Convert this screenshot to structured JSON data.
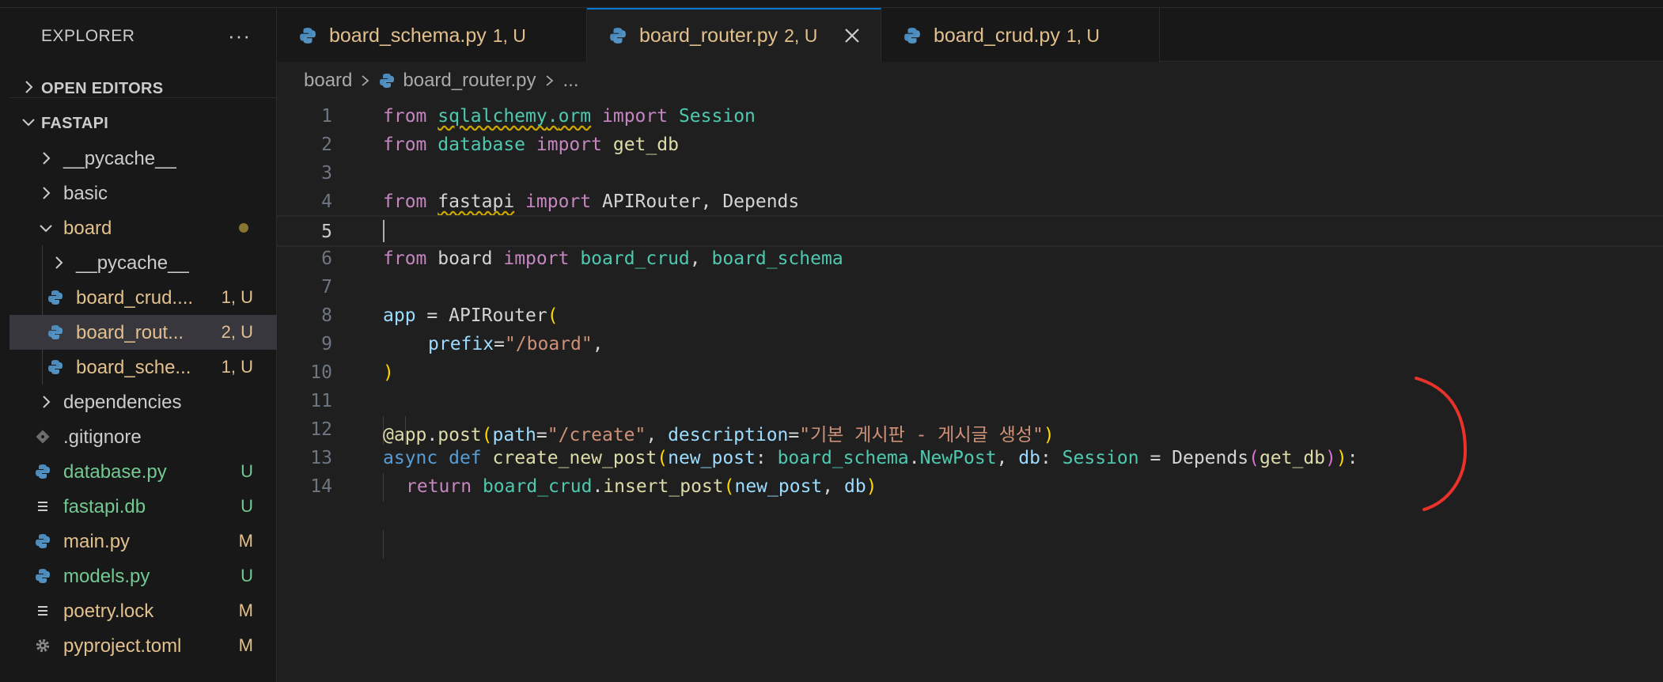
{
  "explorer": {
    "title": "EXPLORER",
    "more": "···",
    "sections": {
      "open_editors": "OPEN EDITORS",
      "project": "FASTAPI"
    },
    "items": [
      {
        "name": "__pycache__",
        "type": "folder",
        "badge": ""
      },
      {
        "name": "basic",
        "type": "folder",
        "badge": ""
      },
      {
        "name": "board",
        "type": "folder-open",
        "badge": ""
      },
      {
        "name": "__pycache__",
        "type": "folder",
        "badge": ""
      },
      {
        "name": "board_crud....",
        "type": "python",
        "badge": "1, U"
      },
      {
        "name": "board_rout...",
        "type": "python",
        "badge": "2, U"
      },
      {
        "name": "board_sche...",
        "type": "python",
        "badge": "1, U"
      },
      {
        "name": "dependencies",
        "type": "folder",
        "badge": ""
      },
      {
        "name": ".gitignore",
        "type": "git",
        "badge": ""
      },
      {
        "name": "database.py",
        "type": "python",
        "badge": "U"
      },
      {
        "name": "fastapi.db",
        "type": "text",
        "badge": "U"
      },
      {
        "name": "main.py",
        "type": "python",
        "badge": "M"
      },
      {
        "name": "models.py",
        "type": "python",
        "badge": "U"
      },
      {
        "name": "poetry.lock",
        "type": "text",
        "badge": "M"
      },
      {
        "name": "pyproject.toml",
        "type": "gear",
        "badge": "M"
      }
    ]
  },
  "tabs": [
    {
      "name": "board_schema.py",
      "status": "1, U"
    },
    {
      "name": "board_router.py",
      "status": "2, U",
      "active": true
    },
    {
      "name": "board_crud.py",
      "status": "1, U"
    }
  ],
  "breadcrumb": {
    "folder": "board",
    "file": "board_router.py",
    "more": "..."
  },
  "editor": {
    "line_numbers": [
      "1",
      "2",
      "3",
      "4",
      "5",
      "6",
      "7",
      "8",
      "9",
      "10",
      "11",
      "12",
      "13",
      "14"
    ],
    "current_line": 5,
    "tokens": {
      "l1": [
        "from",
        "sqlalchemy",
        ".",
        "orm",
        "import",
        "Session"
      ],
      "l2": [
        "from",
        "database",
        "import",
        "get_db"
      ],
      "l4": [
        "from",
        "fastapi",
        "import",
        "APIRouter, Depends"
      ],
      "l6": [
        "from",
        "board",
        "import",
        "board_crud",
        ", ",
        "board_schema"
      ],
      "l8": [
        "app",
        " = ",
        "APIRouter",
        "("
      ],
      "l9": [
        "prefix",
        "=",
        "\"/board\"",
        ","
      ],
      "l10": [
        ")"
      ],
      "l12": [
        "@app",
        ".",
        "post",
        "(",
        "path",
        "=",
        "\"/create\"",
        ", ",
        "description",
        "=",
        "\"기본 게시판 - 게시글 생성\"",
        ")"
      ],
      "l13": [
        "async",
        "def",
        "create_new_post",
        "(",
        "new_post",
        ": ",
        "board_schema",
        ".",
        "NewPost",
        ", ",
        "db",
        ": ",
        "Session",
        " = ",
        "Depends",
        "(",
        "get_db",
        ")",
        ")",
        ":"
      ],
      "l14": [
        "return",
        "board_crud",
        ".",
        "insert_post",
        "(",
        "new_post",
        ", ",
        "db",
        ")"
      ]
    }
  },
  "colors": {
    "accent": "#0078d4",
    "untracked_file": "#73c991",
    "modified_file": "#e2c08d",
    "annotation": "#e8322a"
  }
}
